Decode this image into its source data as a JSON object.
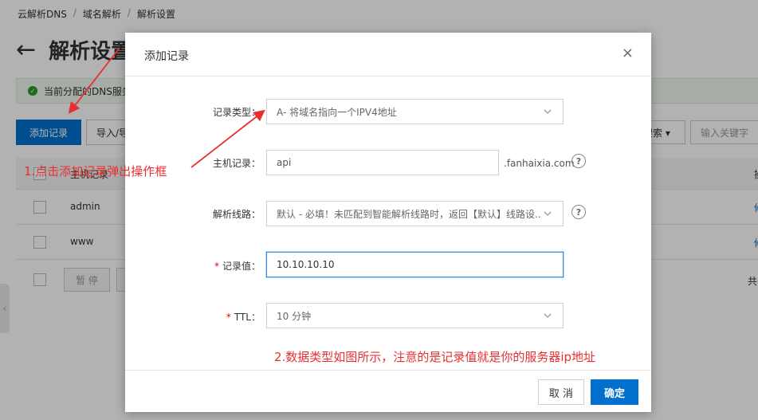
{
  "breadcrumb": {
    "item1": "云解析DNS",
    "item2": "域名解析",
    "item3": "解析设置",
    "separator": "/"
  },
  "page": {
    "title": "解析设置",
    "back_glyph": "←"
  },
  "notice": {
    "text": "当前分配的DNS服务"
  },
  "toolbar": {
    "add_label": "添加记录",
    "import_label": "导入/导",
    "search_label": "搜索 ▾",
    "keyword_placeholder": "输入关键字"
  },
  "table": {
    "header_label": "主机记录",
    "header_right": "操",
    "rows": [
      {
        "host": "admin",
        "mark": "修"
      },
      {
        "host": "www",
        "mark": "修"
      }
    ],
    "pause_label": "暂 停",
    "total_label": "共"
  },
  "side_handle": {
    "glyph": "‹"
  },
  "modal": {
    "title": "添加记录",
    "close_glyph": "×",
    "record_type": {
      "label": "记录类型：",
      "value": "A- 将域名指向一个IPV4地址"
    },
    "host": {
      "label": "主机记录：",
      "value": "api",
      "suffix": ".fanhaixia.com",
      "help": "?"
    },
    "line": {
      "label": "解析线路：",
      "value": "默认 - 必填！未匹配到智能解析线路时，返回【默认】线路设...",
      "help": "?"
    },
    "record_value": {
      "required": "*",
      "label": "记录值：",
      "value": "10.10.10.10"
    },
    "ttl": {
      "required": "*",
      "label": "TTL：",
      "value": "10 分钟"
    },
    "cancel_label": "取 消",
    "ok_label": "确定"
  },
  "annotations": {
    "step1": "1.点击添加记录弹出操作框",
    "step2": "2.数据类型如图所示，注意的是记录值就是你的服务器ip地址",
    "color": "#e83030"
  },
  "colors": {
    "primary": "#0070cc",
    "required": "#e00000"
  }
}
